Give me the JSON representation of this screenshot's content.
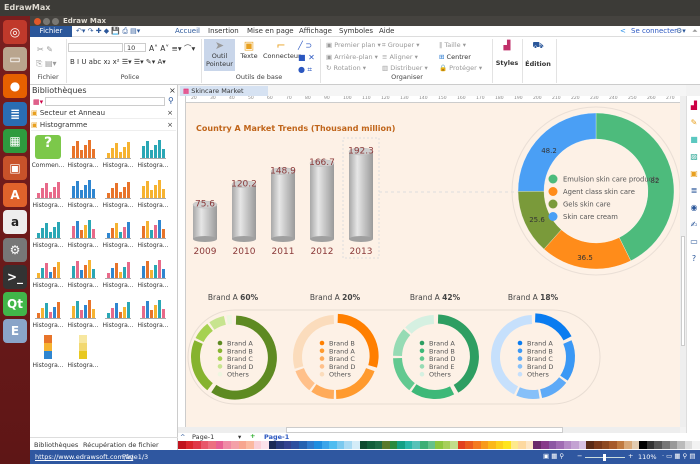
{
  "os": {
    "topbar_title": "EdrawMax",
    "launcher": [
      {
        "name": "ubuntu-icon",
        "color": "#c0392b",
        "glyph": "◎"
      },
      {
        "name": "files-icon",
        "color": "#b9a58e",
        "glyph": "▭"
      },
      {
        "name": "firefox-icon",
        "color": "#e66000",
        "glyph": "●"
      },
      {
        "name": "writer-icon",
        "color": "#2a6db3",
        "glyph": "≣"
      },
      {
        "name": "calc-icon",
        "color": "#2e9b3e",
        "glyph": "▦"
      },
      {
        "name": "impress-icon",
        "color": "#c8522a",
        "glyph": "▣"
      },
      {
        "name": "software-center-icon",
        "color": "#e0622b",
        "glyph": "A"
      },
      {
        "name": "amazon-icon",
        "color": "#eee",
        "glyph": "a"
      },
      {
        "name": "settings-icon",
        "color": "#777",
        "glyph": "⚙"
      },
      {
        "name": "terminal-icon",
        "color": "#333",
        "glyph": ">_"
      },
      {
        "name": "qt-icon",
        "color": "#41b649",
        "glyph": "Qt"
      },
      {
        "name": "edraw-icon",
        "color": "#8aa4c8",
        "glyph": "E"
      }
    ]
  },
  "window": {
    "title": "Edraw Max"
  },
  "menu": {
    "file": "Fichier",
    "tabs": [
      "Accueil",
      "Insertion",
      "Mise en page",
      "Affichage",
      "Symboles",
      "Aide"
    ],
    "signin": "Se connecter"
  },
  "ribbon": {
    "font_size": "10",
    "groups": {
      "fichier": "Fichier",
      "police": "Police",
      "outils": "Outils de base",
      "organiser": "Organiser"
    },
    "tools": {
      "pointer": "Outil",
      "pointer2": "Pointeur",
      "text": "Texte",
      "connector": "Connecteur"
    },
    "arrange": [
      "Premier plan",
      "Arrière-plan",
      "Rotation",
      "Grouper",
      "Aligner",
      "Distribuer",
      "Taille",
      "Centrer",
      "Protéger"
    ],
    "styles": "Styles",
    "edition": "Édition"
  },
  "library": {
    "title": "Bibliothèques",
    "sections": [
      "Secteur et Anneau",
      "Histogramme"
    ],
    "items": [
      "Commen...",
      "Histogra...",
      "Histogra...",
      "Histogra...",
      "Histogra...",
      "Histogra...",
      "Histogra...",
      "Histogra...",
      "Histogra...",
      "Histogra...",
      "Histogra...",
      "Histogra...",
      "Histogra...",
      "Histogra...",
      "Histogra...",
      "Histogra...",
      "Histogra...",
      "Histogra...",
      "Histogra...",
      "Histogra...",
      "Histogra...",
      "Histogra..."
    ],
    "bottom_tabs": [
      "Bibliothèques",
      "Récupération de fichier"
    ]
  },
  "document": {
    "tab": "Skincare Market Trends",
    "ruler": [
      "20",
      "30",
      "40",
      "50",
      "60",
      "70",
      "80",
      "90",
      "100",
      "110",
      "120",
      "130",
      "140",
      "150",
      "160",
      "170",
      "180",
      "190",
      "200",
      "210",
      "220",
      "230",
      "240",
      "250",
      "260",
      "270"
    ]
  },
  "chart_data": [
    {
      "type": "bar",
      "title": "Country A Market Trends (Thousand million)",
      "categories": [
        "2009",
        "2010",
        "2011",
        "2012",
        "2013"
      ],
      "values": [
        75.6,
        120.2,
        148.9,
        166.7,
        192.3
      ],
      "style": "3d-cylinder",
      "color": "#c8c8c8"
    },
    {
      "type": "pie",
      "style": "donut",
      "legend": "center",
      "series": [
        {
          "name": "Emulsion skin care products",
          "value": 82,
          "color": "#4dbb7c"
        },
        {
          "name": "Agent class skin care",
          "value": 36.5,
          "color": "#ff8c1a"
        },
        {
          "name": "Gels skin care",
          "value": 25.6,
          "color": "#7a9a3a"
        },
        {
          "name": "Skin care cream",
          "value": 48.2,
          "color": "#4a9ff5"
        }
      ]
    },
    {
      "type": "pie",
      "style": "donut",
      "title_label": "Brand A",
      "title_value": "60%",
      "labels": [
        "Brand A",
        "Brand B",
        "Brand C",
        "Brand D",
        "Others"
      ],
      "values": [
        60,
        22,
        8,
        7,
        3
      ],
      "colors": [
        "#5e8a22",
        "#86b32f",
        "#a6d150",
        "#c7e48f",
        "#eef6e0"
      ]
    },
    {
      "type": "pie",
      "style": "donut",
      "title_label": "Brand A",
      "title_value": "20%",
      "labels": [
        "Brand B",
        "Brand A",
        "Brand C",
        "Brand D",
        "Others"
      ],
      "values": [
        30,
        20,
        10,
        10,
        30
      ],
      "colors": [
        "#ff7f00",
        "#ff9a2e",
        "#ffab5a",
        "#ffc08a",
        "#fbdcbc"
      ]
    },
    {
      "type": "pie",
      "style": "donut",
      "title_label": "Brand A",
      "title_value": "42%",
      "labels": [
        "Brand A",
        "Brand B",
        "Brand D",
        "Brand E",
        "Others"
      ],
      "values": [
        42,
        18,
        15,
        12,
        13
      ],
      "colors": [
        "#2e9e62",
        "#3db878",
        "#62c990",
        "#96dbb4",
        "#d5f0e1"
      ]
    },
    {
      "type": "pie",
      "style": "donut",
      "title_label": "Brand A",
      "title_value": "18%",
      "labels": [
        "Brand A",
        "Brand B",
        "Brand C",
        "Brand D",
        "Others"
      ],
      "values": [
        18,
        17,
        12,
        10,
        43
      ],
      "colors": [
        "#0a7cf0",
        "#3a98f5",
        "#5eaaf7",
        "#86c0f9",
        "#c6e0fc"
      ]
    }
  ],
  "pages": {
    "selector": "Page-1",
    "active": "Page-1"
  },
  "palette": [
    "#c0141e",
    "#d9262e",
    "#e03848",
    "#e8576a",
    "#ec6f80",
    "#e75f93",
    "#f08aa5",
    "#f4a0a8",
    "#f7a58f",
    "#fbb9a0",
    "#f9d0d8",
    "#fbe2ea",
    "#1b2a56",
    "#27397a",
    "#33428f",
    "#2c4f9f",
    "#2462b0",
    "#2f7bcc",
    "#1f8ee0",
    "#3aa5ea",
    "#4dbcf0",
    "#7bc9ef",
    "#a9daf3",
    "#d4ecf8",
    "#0f4a2f",
    "#135e3a",
    "#1e6b45",
    "#5a7a2a",
    "#2b8a3e",
    "#14a085",
    "#2ab7a9",
    "#56c2b8",
    "#3daf74",
    "#64c18b",
    "#8cc63f",
    "#a6cf5a",
    "#c2de8a",
    "#e2411f",
    "#ea5b1f",
    "#f47a20",
    "#f89a1c",
    "#fbb81a",
    "#fdd01c",
    "#ffe51e",
    "#fde98c",
    "#fdd9a0",
    "#fde6c6",
    "#6b2a6b",
    "#873a8a",
    "#8c58a3",
    "#a06cb3",
    "#b58ac6",
    "#c3a2d2",
    "#d7c1e2",
    "#5a2a16",
    "#7a3a1c",
    "#8e4a22",
    "#a65a2a",
    "#c07a40",
    "#d8a878",
    "#e2cbb0",
    "#000000",
    "#333333",
    "#555555",
    "#777777",
    "#999999",
    "#bbbbbb",
    "#dddddd",
    "#f2f2f2"
  ],
  "status": {
    "url": "https://www.edrawsoft.com/fr/",
    "page": "Page1/3",
    "zoom": "110%",
    "zoom_level": 0.45
  }
}
